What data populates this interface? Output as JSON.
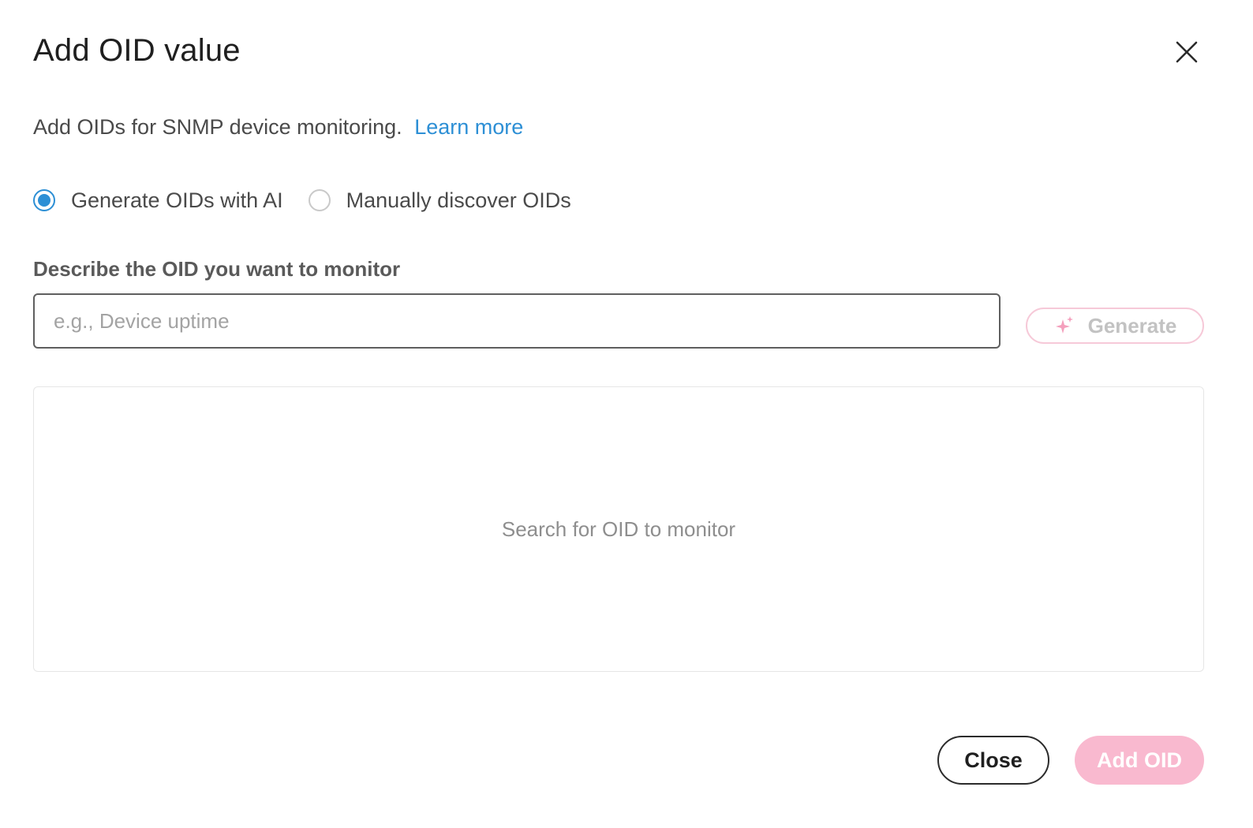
{
  "dialog": {
    "title": "Add OID value",
    "close_icon": "close-icon"
  },
  "intro": {
    "text": "Add OIDs for SNMP device monitoring.",
    "link_label": "Learn more"
  },
  "mode": {
    "options": [
      {
        "label": "Generate OIDs with AI",
        "checked": true
      },
      {
        "label": "Manually discover OIDs",
        "checked": false
      }
    ]
  },
  "describe": {
    "label": "Describe the OID you want to monitor",
    "placeholder": "e.g., Device uptime",
    "value": "",
    "generate_label": "Generate",
    "generate_icon": "sparkle-icon"
  },
  "results": {
    "empty_text": "Search for OID to monitor"
  },
  "footer": {
    "close_label": "Close",
    "add_label": "Add OID"
  },
  "colors": {
    "accent_blue": "#2d8fd5",
    "brand_pink": "#f9b9cf",
    "spark_pink": "#f4a0bd"
  }
}
